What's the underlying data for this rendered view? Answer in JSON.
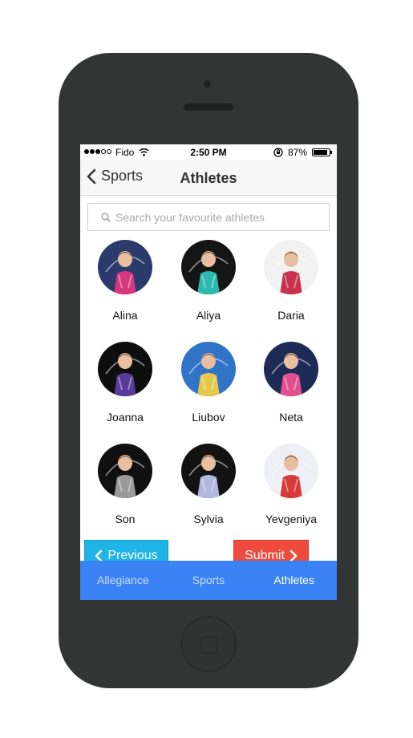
{
  "status_bar": {
    "carrier": "Fido",
    "time": "2:50 PM",
    "battery": "87%"
  },
  "nav": {
    "back_label": "Sports",
    "title": "Athletes"
  },
  "search": {
    "placeholder": "Search your favourite athletes",
    "value": ""
  },
  "athletes": [
    {
      "name": "Alina",
      "bg": "#2a3a6a",
      "outfit": "#d6377e"
    },
    {
      "name": "Aliya",
      "bg": "#151515",
      "outfit": "#2db8b0"
    },
    {
      "name": "Daria",
      "bg": "#f2f2f2",
      "outfit": "#c8324c"
    },
    {
      "name": "Joanna",
      "bg": "#0e0e0e",
      "outfit": "#5a3a9a"
    },
    {
      "name": "Liubov",
      "bg": "#2f74c8",
      "outfit": "#e6c84a"
    },
    {
      "name": "Neta",
      "bg": "#1d2a55",
      "outfit": "#e0508e"
    },
    {
      "name": "Son",
      "bg": "#101010",
      "outfit": "#9a9a9a"
    },
    {
      "name": "Sylvia",
      "bg": "#121212",
      "outfit": "#b0b8e0"
    },
    {
      "name": "Yevgeniya",
      "bg": "#eef0f6",
      "outfit": "#d83a3a"
    }
  ],
  "buttons": {
    "previous": "Previous",
    "submit": "Submit"
  },
  "tabs": [
    {
      "label": "Allegiance",
      "active": false
    },
    {
      "label": "Sports",
      "active": false
    },
    {
      "label": "Athletes",
      "active": true
    }
  ],
  "colors": {
    "tab_bar": "#3b82f4",
    "previous_button": "#1eb4e6",
    "submit_button": "#ee4b3e"
  }
}
